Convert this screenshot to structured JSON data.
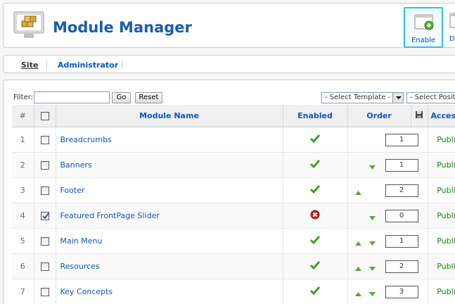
{
  "header": {
    "title": "Module Manager",
    "buttons": [
      {
        "label": "Enable",
        "icon": "enable-icon"
      },
      {
        "label": "Disable",
        "icon": "disable-icon"
      }
    ]
  },
  "submenu": {
    "tabs": [
      "Site",
      "Administrator"
    ],
    "active": "Site"
  },
  "filter": {
    "label": "Filter:",
    "value": "",
    "go_label": "Go",
    "reset_label": "Reset",
    "template_select": "- Select Template -",
    "position_select": "- Select Position -"
  },
  "columns": {
    "num": "#",
    "name": "Module Name",
    "enabled": "Enabled",
    "order": "Order",
    "access": "Access Level"
  },
  "rows": [
    {
      "num": "1",
      "name": "Breadcrumbs",
      "checked": false,
      "enabled": true,
      "up": false,
      "down": false,
      "order": "1",
      "access": "Public"
    },
    {
      "num": "2",
      "name": "Banners",
      "checked": false,
      "enabled": true,
      "up": false,
      "down": true,
      "order": "1",
      "access": "Public"
    },
    {
      "num": "3",
      "name": "Footer",
      "checked": false,
      "enabled": true,
      "up": true,
      "down": false,
      "order": "2",
      "access": "Public"
    },
    {
      "num": "4",
      "name": "Featured FrontPage Slider",
      "checked": true,
      "enabled": false,
      "up": false,
      "down": true,
      "order": "0",
      "access": "Public"
    },
    {
      "num": "5",
      "name": "Main Menu",
      "checked": false,
      "enabled": true,
      "up": true,
      "down": true,
      "order": "1",
      "access": "Public"
    },
    {
      "num": "6",
      "name": "Resources",
      "checked": false,
      "enabled": true,
      "up": true,
      "down": true,
      "order": "2",
      "access": "Public"
    },
    {
      "num": "7",
      "name": "Key Concepts",
      "checked": false,
      "enabled": true,
      "up": true,
      "down": true,
      "order": "3",
      "access": "Public"
    }
  ],
  "colors": {
    "link": "#0b55c4",
    "access": "#188018",
    "enabled": "#3aa51a",
    "disabled": "#d42020",
    "highlight": "#27c1e8"
  }
}
